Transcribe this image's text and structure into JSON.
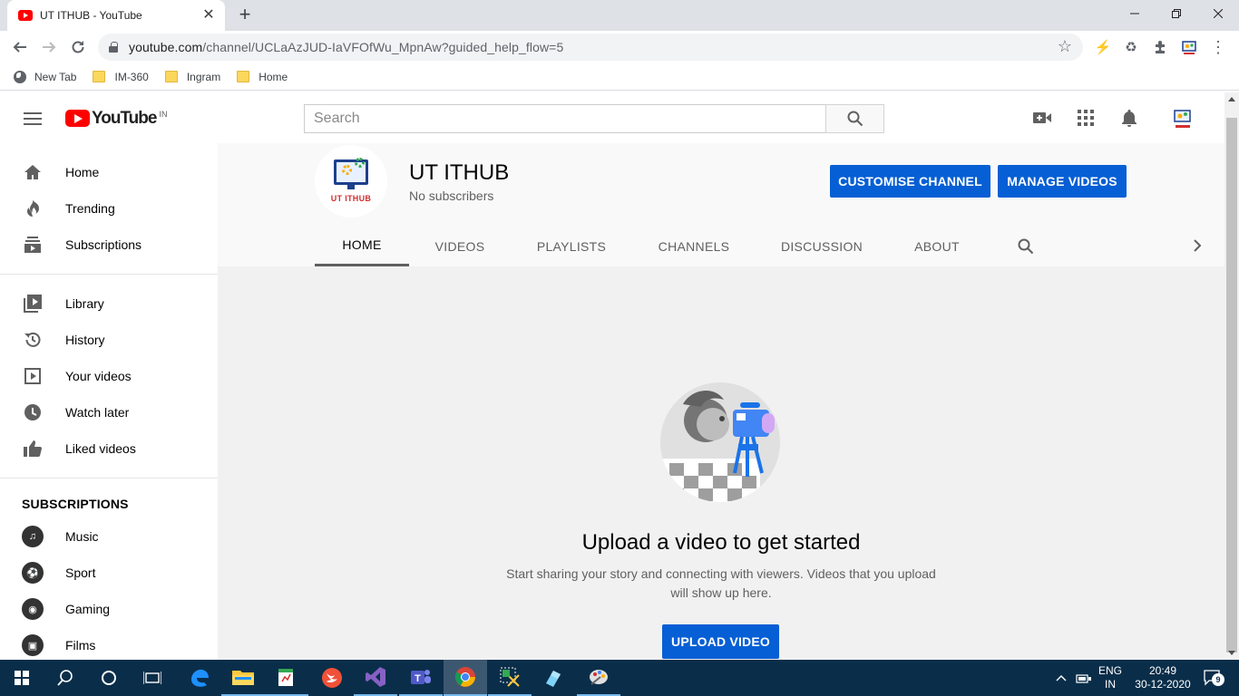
{
  "browser": {
    "tab_title": "UT ITHUB - YouTube",
    "tab_close": "✕",
    "new_tab": "+",
    "url_host": "youtube.com",
    "url_path": "/channel/UCLaAzJUD-IaVFOfWu_MpnAw?guided_help_flow=5",
    "bookmarks": [
      {
        "label": "New Tab",
        "icon": "globe-icon"
      },
      {
        "label": "IM-360",
        "icon": "folder-icon"
      },
      {
        "label": "Ingram",
        "icon": "folder-icon"
      },
      {
        "label": "Home",
        "icon": "folder-icon"
      }
    ]
  },
  "masthead": {
    "logo_text": "YouTube",
    "country_code": "IN",
    "search_placeholder": "Search"
  },
  "sidebar": {
    "primary": [
      {
        "label": "Home",
        "icon": "home-icon"
      },
      {
        "label": "Trending",
        "icon": "trending-icon"
      },
      {
        "label": "Subscriptions",
        "icon": "subscriptions-icon"
      }
    ],
    "secondary": [
      {
        "label": "Library",
        "icon": "library-icon"
      },
      {
        "label": "History",
        "icon": "history-icon"
      },
      {
        "label": "Your videos",
        "icon": "your-videos-icon"
      },
      {
        "label": "Watch later",
        "icon": "watch-later-icon"
      },
      {
        "label": "Liked videos",
        "icon": "liked-videos-icon"
      }
    ],
    "subscriptions_heading": "SUBSCRIPTIONS",
    "subscriptions": [
      {
        "label": "Music",
        "icon": "music-icon"
      },
      {
        "label": "Sport",
        "icon": "sport-icon"
      },
      {
        "label": "Gaming",
        "icon": "gaming-icon"
      },
      {
        "label": "Films",
        "icon": "films-icon"
      }
    ]
  },
  "channel": {
    "avatar_brand": "UT ITHUB",
    "name": "UT ITHUB",
    "subscribers": "No subscribers",
    "customise_label": "CUSTOMISE CHANNEL",
    "manage_label": "MANAGE VIDEOS",
    "tabs": [
      "HOME",
      "VIDEOS",
      "PLAYLISTS",
      "CHANNELS",
      "DISCUSSION",
      "ABOUT"
    ],
    "active_tab": "HOME"
  },
  "empty_state": {
    "title": "Upload a video to get started",
    "description": "Start sharing your story and connecting with viewers. Videos that you upload will show up here.",
    "button_label": "UPLOAD VIDEO"
  },
  "taskbar": {
    "language_line1": "ENG",
    "language_line2": "IN",
    "time": "20:49",
    "date": "30-12-2020",
    "notifications": "9"
  },
  "colors": {
    "accent_blue": "#065fd4",
    "youtube_red": "#ff0000",
    "taskbar": "#0a2e4a"
  }
}
